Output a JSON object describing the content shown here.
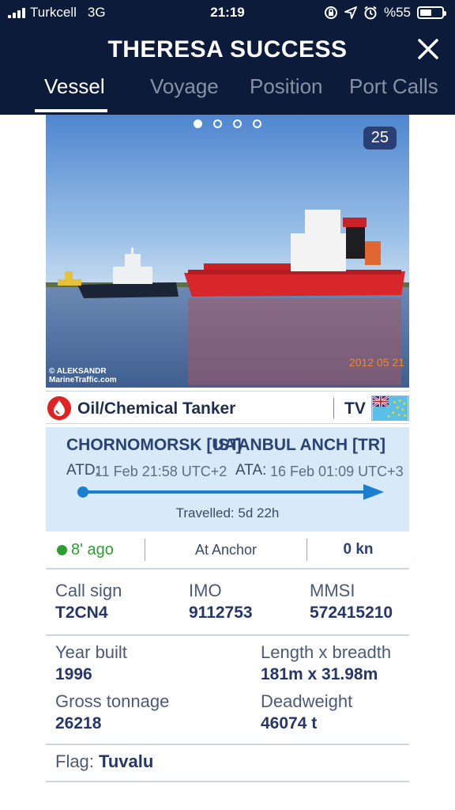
{
  "status_bar": {
    "carrier": "Turkcell",
    "network": "3G",
    "time": "21:19",
    "battery": "%55",
    "battery_level": 0.55,
    "icons": [
      "signal-icon",
      "rotation-lock-icon",
      "location-arrow-icon",
      "alarm-icon",
      "battery-icon"
    ]
  },
  "header": {
    "title": "THERESA SUCCESS",
    "close_icon": "close-icon",
    "tabs": [
      {
        "label": "Vessel",
        "active": true
      },
      {
        "label": "Voyage",
        "active": false
      },
      {
        "label": "Position",
        "active": false
      },
      {
        "label": "Port Calls",
        "active": false
      }
    ]
  },
  "photo": {
    "count": "25",
    "carousel_pages": 4,
    "carousel_active": 0,
    "credit_line1": "© ALEKSANDR",
    "credit_line2": "MarineTraffic.com",
    "date_stamp": "2012 05 21"
  },
  "vessel": {
    "type": "Oil/Chemical Tanker",
    "type_icon": "oil-drop-icon",
    "type_icon_color": "#e02222",
    "flag_code": "TV"
  },
  "voyage": {
    "from_port": "CHORNOMORSK [UA]",
    "to_port": "ISTANBUL ANCH [TR]",
    "atd_label": "ATD:",
    "atd_value": "11 Feb 21:58 UTC+2",
    "ata_label": "ATA:",
    "ata_value": "16 Feb 01:09 UTC+3",
    "travelled": "Travelled: 5d 22h",
    "progress": 1.0,
    "accent_color": "#1b7fd1"
  },
  "status": {
    "last_seen": "8' ago",
    "nav_status": "At Anchor",
    "speed": "0 kn",
    "indicator_color": "#2e9e30"
  },
  "details": {
    "call_sign_label": "Call sign",
    "call_sign": "T2CN4",
    "imo_label": "IMO",
    "imo": "9112753",
    "mmsi_label": "MMSI",
    "mmsi": "572415210",
    "year_built_label": "Year built",
    "year_built": "1996",
    "length_label": "Length x breadth",
    "length": "181m x 31.98m",
    "gross_label": "Gross tonnage",
    "gross": "26218",
    "deadweight_label": "Deadweight",
    "deadweight": "46074 t",
    "flag_label": "Flag:",
    "flag": "Tuvalu"
  }
}
